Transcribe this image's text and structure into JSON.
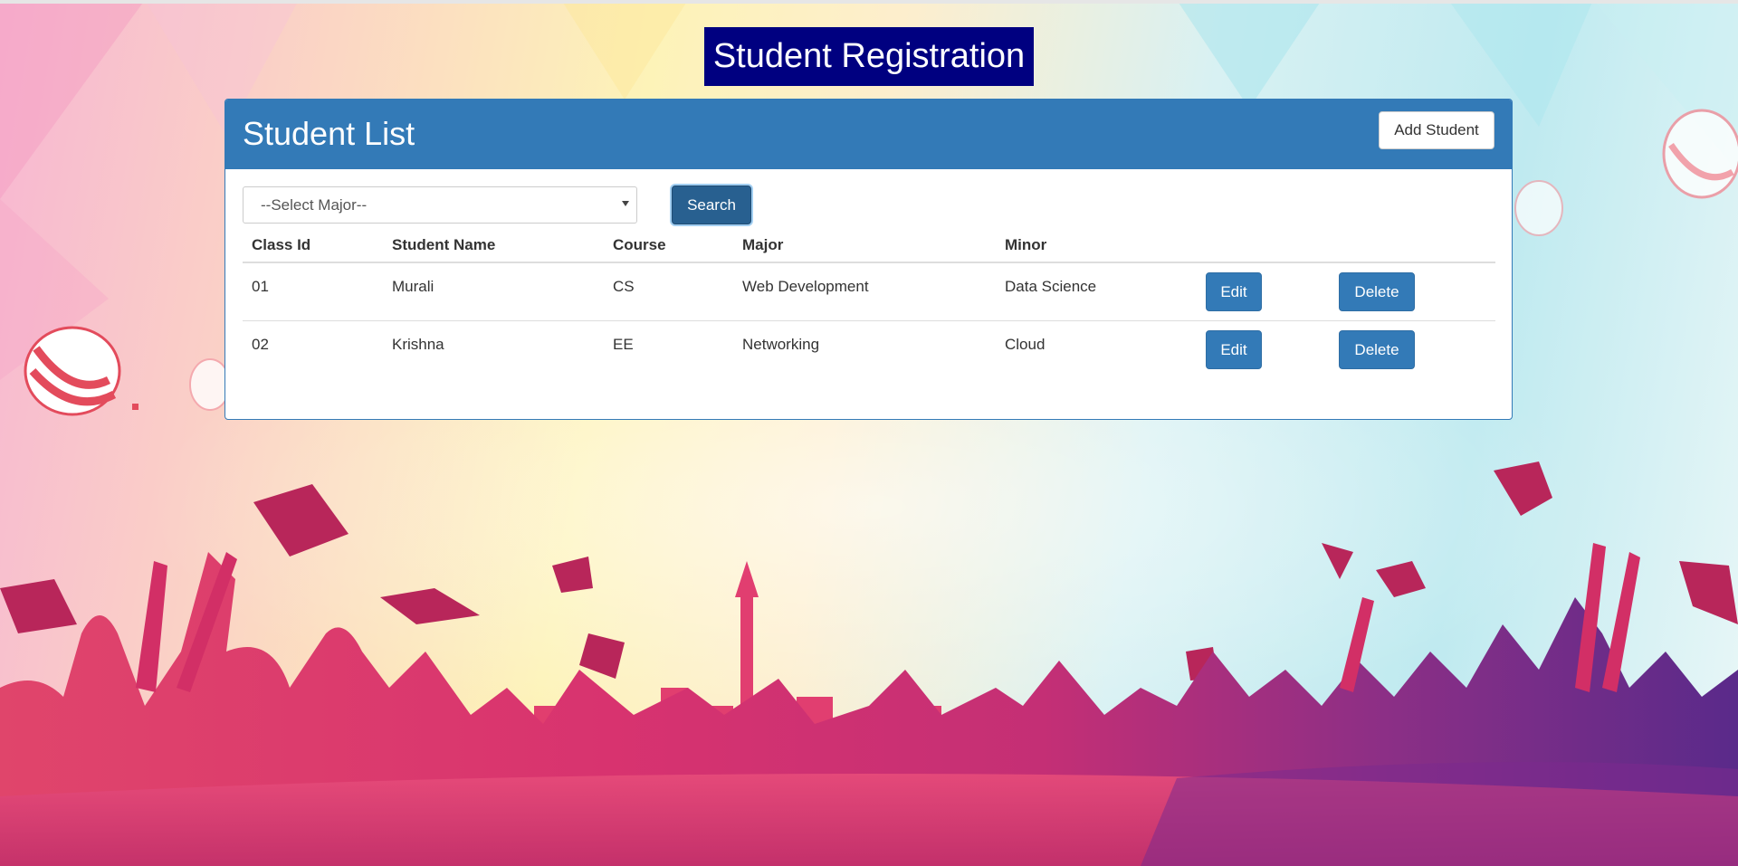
{
  "page": {
    "title": "Student Registration"
  },
  "panel": {
    "title": "Student List",
    "add_button_label": "Add Student"
  },
  "filter": {
    "select_value": "--Select Major--",
    "search_button_label": "Search"
  },
  "table": {
    "headers": [
      "Class Id",
      "Student Name",
      "Course",
      "Major",
      "Minor"
    ],
    "rows": [
      {
        "class_id": "01",
        "name": "Murali",
        "course": "CS",
        "major": "Web Development",
        "minor": "Data Science",
        "edit_label": "Edit",
        "delete_label": "Delete"
      },
      {
        "class_id": "02",
        "name": "Krishna",
        "course": "EE",
        "major": "Networking",
        "minor": "Cloud",
        "edit_label": "Edit",
        "delete_label": "Delete"
      }
    ]
  },
  "colors": {
    "title_bg": "#000080",
    "panel_primary": "#337ab7",
    "search_active": "#286090"
  }
}
